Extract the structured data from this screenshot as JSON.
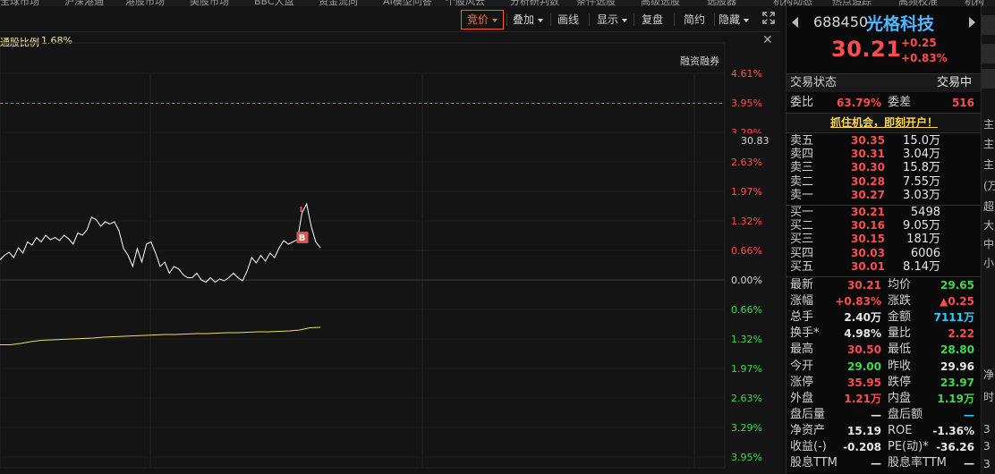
{
  "top_strip": [
    "全球市场",
    "沪深港通",
    "港股市场",
    "美股市场",
    "BBC大盘",
    "资金流向",
    "AI模型问答",
    "个股风云",
    "分析研判数",
    "条件选股",
    "高级选股",
    "选股器",
    "机构动态",
    "热点追踪",
    "高频校准",
    "机构"
  ],
  "toolbar": {
    "bid_price": "竞价",
    "overlay": "叠加",
    "draw_line": "画线",
    "display": "显示",
    "replay": "复盘",
    "simple": "简约",
    "hide": "隐藏"
  },
  "sub_header": {
    "ratio_label": "通股比例",
    "ratio_value": "1.68%",
    "margin_label": "融资融券"
  },
  "axis": {
    "right_labels": [
      "4.61%",
      "3.95%",
      "3.29%",
      "2.63%",
      "1.97%",
      "1.32%",
      "0.66%",
      "0.00%",
      "0.66%",
      "1.32%",
      "1.97%",
      "2.63%",
      "3.29%",
      "3.95%"
    ],
    "price_tag": "30.83",
    "marker_label": "B"
  },
  "chart_data": {
    "type": "line",
    "y_axis_percent": {
      "max": 4.61,
      "min": -3.95,
      "ticks": [
        4.61,
        3.95,
        3.29,
        2.63,
        1.97,
        1.32,
        0.66,
        0.0,
        -0.66,
        -1.32,
        -1.97,
        -2.63,
        -3.29,
        -3.95
      ]
    },
    "reference_line_percent": 3.95,
    "price_series_percent": [
      0.45,
      0.55,
      0.62,
      0.5,
      0.72,
      0.6,
      0.85,
      0.78,
      0.95,
      0.85,
      1.0,
      0.9,
      0.95,
      0.88,
      1.0,
      0.92,
      0.8,
      1.05,
      1.0,
      1.12,
      1.4,
      1.35,
      1.2,
      1.3,
      1.25,
      1.3,
      1.1,
      0.7,
      0.55,
      0.3,
      0.7,
      0.4,
      0.8,
      0.85,
      0.6,
      0.3,
      0.4,
      0.15,
      0.3,
      0.25,
      0.12,
      0.05,
      0.05,
      0.15,
      0.0,
      -0.05,
      0.05,
      -0.05,
      0.02,
      -0.02,
      0.05,
      0.15,
      0.05,
      -0.02,
      0.2,
      0.5,
      0.38,
      0.55,
      0.42,
      0.6,
      0.5,
      0.72,
      0.88,
      0.8,
      0.85,
      0.9,
      1.5,
      1.7,
      1.2,
      0.85,
      0.72
    ],
    "volume_ratio_series_percent": [
      -1.45,
      -1.45,
      -1.42,
      -1.38,
      -1.35,
      -1.34,
      -1.33,
      -1.32,
      -1.31,
      -1.3,
      -1.28,
      -1.27,
      -1.26,
      -1.25,
      -1.24,
      -1.23,
      -1.22,
      -1.22,
      -1.21,
      -1.2,
      -1.2,
      -1.19,
      -1.18,
      -1.18,
      -1.17,
      -1.16,
      -1.16,
      -1.15,
      -1.14,
      -1.12,
      -1.07,
      -1.06
    ],
    "marker": {
      "label": "B",
      "index": 66
    }
  },
  "quote": {
    "code": "688450",
    "name": "光格科技",
    "last_price": "30.21",
    "change": "+0.25",
    "change_pct": "+0.83%",
    "trade_status_label": "交易状态",
    "trade_status_value": "交易中",
    "commission_ratio_label": "委比",
    "commission_ratio_value": "63.79%",
    "commission_diff_label": "委差",
    "commission_diff_value": "516",
    "ad_banner": "抓住机会，即刻开户！"
  },
  "order_book": {
    "asks": [
      {
        "label": "卖五",
        "price": "30.35",
        "volume": "15.0万"
      },
      {
        "label": "卖四",
        "price": "30.31",
        "volume": "3.04万"
      },
      {
        "label": "卖三",
        "price": "30.30",
        "volume": "15.8万"
      },
      {
        "label": "卖二",
        "price": "30.28",
        "volume": "7.55万"
      },
      {
        "label": "卖一",
        "price": "30.27",
        "volume": "3.03万"
      }
    ],
    "bids": [
      {
        "label": "买一",
        "price": "30.21",
        "volume": "5498"
      },
      {
        "label": "买二",
        "price": "30.16",
        "volume": "9.05万"
      },
      {
        "label": "买三",
        "price": "30.15",
        "volume": "181万"
      },
      {
        "label": "买四",
        "price": "30.03",
        "volume": "6006"
      },
      {
        "label": "买五",
        "price": "30.01",
        "volume": "8.14万"
      }
    ]
  },
  "stats": [
    {
      "l1": "最新",
      "v1": "30.21",
      "c1": "red",
      "l2": "均价",
      "v2": "29.65",
      "c2": "green"
    },
    {
      "l1": "涨幅",
      "v1": "+0.83%",
      "c1": "red",
      "l2": "涨跌",
      "v2": "▲0.25",
      "c2": "red"
    },
    {
      "l1": "总手",
      "v1": "2.40万",
      "c1": "white",
      "l2": "金额",
      "v2": "7111万",
      "c2": "cyan"
    },
    {
      "l1": "换手*",
      "v1": "4.98%",
      "c1": "white",
      "l2": "量比",
      "v2": "2.22",
      "c2": "red"
    },
    {
      "l1": "最高",
      "v1": "30.50",
      "c1": "red",
      "l2": "最低",
      "v2": "28.80",
      "c2": "green"
    },
    {
      "l1": "今开",
      "v1": "29.00",
      "c1": "green",
      "l2": "昨收",
      "v2": "29.96",
      "c2": "white"
    },
    {
      "l1": "涨停",
      "v1": "35.95",
      "c1": "red",
      "l2": "跌停",
      "v2": "23.97",
      "c2": "green"
    },
    {
      "l1": "外盘",
      "v1": "1.21万",
      "c1": "red",
      "l2": "内盘",
      "v2": "1.19万",
      "c2": "green"
    },
    {
      "l1": "盘后量",
      "v1": "—",
      "c1": "white",
      "l2": "盘后额",
      "v2": "—",
      "c2": "cyan"
    },
    {
      "l1": "净资产",
      "v1": "15.19",
      "c1": "white",
      "l2": "ROE",
      "v2": "-1.36%",
      "c2": "white"
    },
    {
      "l1": "收益(-)",
      "v1": "-0.208",
      "c1": "white",
      "l2": "PE(动)*",
      "v2": "-36.26",
      "c2": "white"
    },
    {
      "l1": "股息TTM",
      "v1": "—",
      "c1": "white",
      "l2": "股息率TTM",
      "v2": "—",
      "c2": "white"
    }
  ],
  "far_strip": [
    "主",
    "主",
    "主",
    "(万",
    "超",
    "大",
    "中",
    "小",
    "净",
    "时",
    "3",
    "3",
    "3"
  ],
  "colors": {
    "up": "#ff4d4d",
    "down": "#3ddc4a",
    "price_line": "#ffffff",
    "volume_line": "#e8e060",
    "reference_line": "#3fa0c8",
    "accent": "#ff5a2a"
  }
}
